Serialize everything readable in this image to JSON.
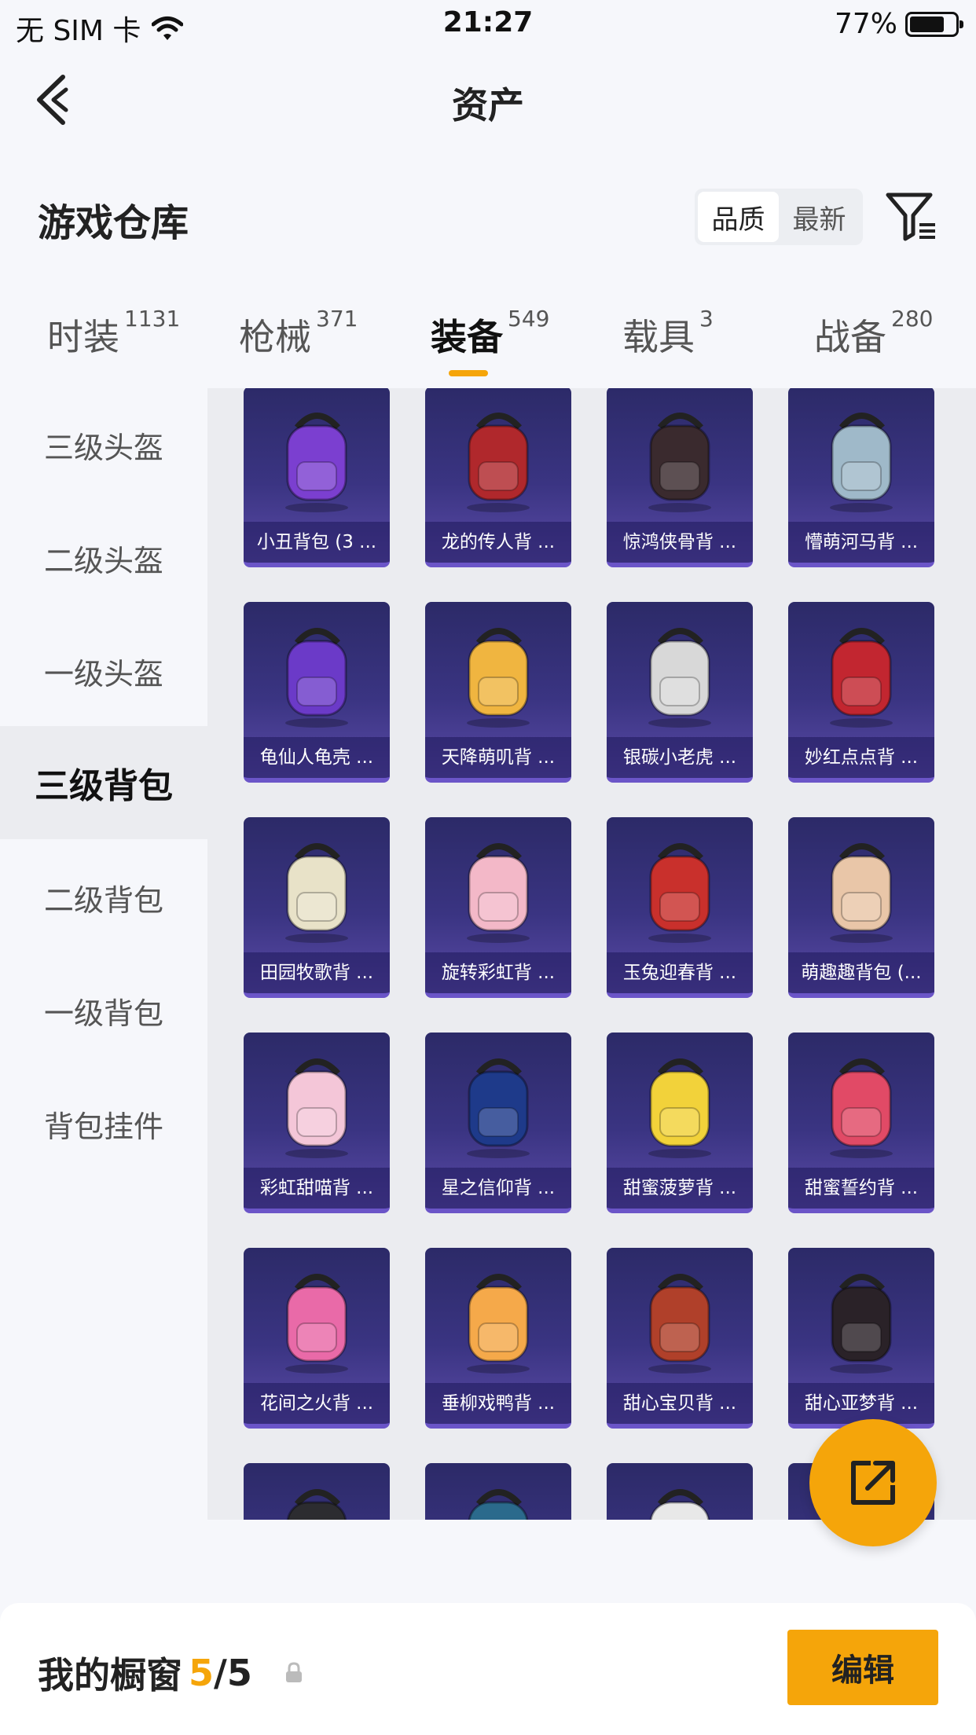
{
  "status_bar": {
    "carrier": "无 SIM 卡",
    "time": "21:27",
    "battery": "77%",
    "battery_level": 0.77
  },
  "nav": {
    "title": "资产"
  },
  "section": {
    "title": "游戏仓库",
    "sort_options": [
      "品质",
      "最新"
    ],
    "sort_selected": "品质"
  },
  "tabs": [
    {
      "label": "时装",
      "count": "1131"
    },
    {
      "label": "枪械",
      "count": "371"
    },
    {
      "label": "装备",
      "count": "549",
      "active": true
    },
    {
      "label": "载具",
      "count": "3"
    },
    {
      "label": "战备",
      "count": "280"
    }
  ],
  "sidebar": {
    "items": [
      "三级头盔",
      "二级头盔",
      "一级头盔",
      "三级背包",
      "二级背包",
      "一级背包",
      "背包挂件"
    ],
    "active": "三级背包"
  },
  "items": [
    {
      "name": "小丑背包 (3 ...",
      "color": "#7b3fd0"
    },
    {
      "name": "龙的传人背 ...",
      "color": "#b0282c"
    },
    {
      "name": "惊鸿侠骨背 ...",
      "color": "#3a2a2e"
    },
    {
      "name": "懵萌河马背 ...",
      "color": "#9fb9c9"
    },
    {
      "name": "龟仙人龟壳 ...",
      "color": "#6b3ac8"
    },
    {
      "name": "天降萌叽背 ...",
      "color": "#f0b540"
    },
    {
      "name": "银碳小老虎 ...",
      "color": "#d8d8d8"
    },
    {
      "name": "妙红点点背 ...",
      "color": "#c22630"
    },
    {
      "name": "田园牧歌背 ...",
      "color": "#e8e2c8"
    },
    {
      "name": "旋转彩虹背 ...",
      "color": "#f3b8c8"
    },
    {
      "name": "玉兔迎春背 ...",
      "color": "#c9302c"
    },
    {
      "name": "萌趣趣背包 (...",
      "color": "#e9c6a8"
    },
    {
      "name": "彩虹甜喵背 ...",
      "color": "#f4c6d8"
    },
    {
      "name": "星之信仰背 ...",
      "color": "#1e3a8a"
    },
    {
      "name": "甜蜜菠萝背 ...",
      "color": "#f2d23a"
    },
    {
      "name": "甜蜜誓约背 ...",
      "color": "#e14a66"
    },
    {
      "name": "花间之火背 ...",
      "color": "#e96aa8"
    },
    {
      "name": "垂柳戏鸭背 ...",
      "color": "#f5a94a"
    },
    {
      "name": "甜心宝贝背 ...",
      "color": "#b0402a"
    },
    {
      "name": "甜心亚梦背 ...",
      "color": "#2a2228"
    },
    {
      "name": "",
      "color": "#2c2c30"
    },
    {
      "name": "",
      "color": "#2b6a8c"
    },
    {
      "name": "",
      "color": "#e8e8e8"
    },
    {
      "name": "",
      "color": "#3a3a40"
    }
  ],
  "showcase": {
    "title": "我的橱窗",
    "current": "5",
    "total": "/5",
    "edit_label": "编辑"
  },
  "colors": {
    "accent": "#f5a50a"
  }
}
